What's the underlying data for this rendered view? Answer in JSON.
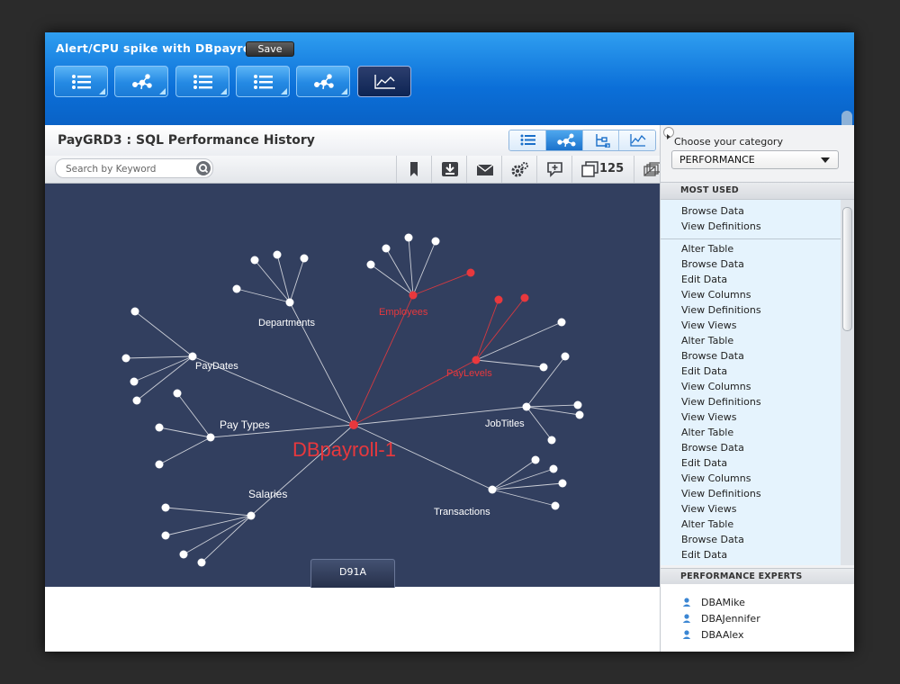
{
  "header": {
    "title": "Alert/CPU spike with DBpayroll",
    "save_label": "Save"
  },
  "toolbar_buttons": [
    {
      "icon": "list-icon"
    },
    {
      "icon": "network-icon"
    },
    {
      "icon": "list-icon"
    },
    {
      "icon": "list-icon"
    },
    {
      "icon": "network-icon"
    },
    {
      "icon": "line-chart-icon",
      "active": true
    }
  ],
  "page": {
    "title": "PayGRD3 : SQL Performance History"
  },
  "view_switcher": [
    "list-icon",
    "network-icon",
    "tree-icon",
    "line-chart-icon"
  ],
  "search": {
    "placeholder": "Search by Keyword"
  },
  "tools": {
    "count": "125",
    "icons": [
      "bookmark-icon",
      "download-icon",
      "mail-icon",
      "gears-icon",
      "comment-icon",
      "copy-icon",
      "stack-icon"
    ]
  },
  "graph": {
    "center_label": "DBpayroll-1",
    "nodes": [
      "Departments",
      "Employees",
      "PayDates",
      "PayLevels",
      "Pay Types",
      "JobTitles",
      "Salaries",
      "Transactions"
    ],
    "bottom_button": "D91A"
  },
  "colors": {
    "highlight": "#e8383d",
    "graph_bg": "#323f5f",
    "accent": "#0b6fd8"
  },
  "panel": {
    "choose_label": "Choose your category",
    "category": "PERFORMANCE",
    "most_used_title": "MOST USED",
    "most_used_top": [
      "Browse Data",
      "View Definitions"
    ],
    "most_used_list": [
      "Alter Table",
      "Browse Data",
      "Edit Data",
      "View Columns",
      "View Definitions",
      "View Views",
      "Alter Table",
      "Browse Data",
      "Edit Data",
      "View Columns",
      "View Definitions",
      "View Views",
      "Alter Table",
      "Browse Data",
      "Edit Data",
      "View Columns",
      "View Definitions",
      "View Views",
      "Alter Table",
      "Browse Data",
      "Edit Data"
    ],
    "experts_title": "PERFORMANCE EXPERTS",
    "experts": [
      "DBAMike",
      "DBAJennifer",
      "DBAAlex"
    ]
  }
}
